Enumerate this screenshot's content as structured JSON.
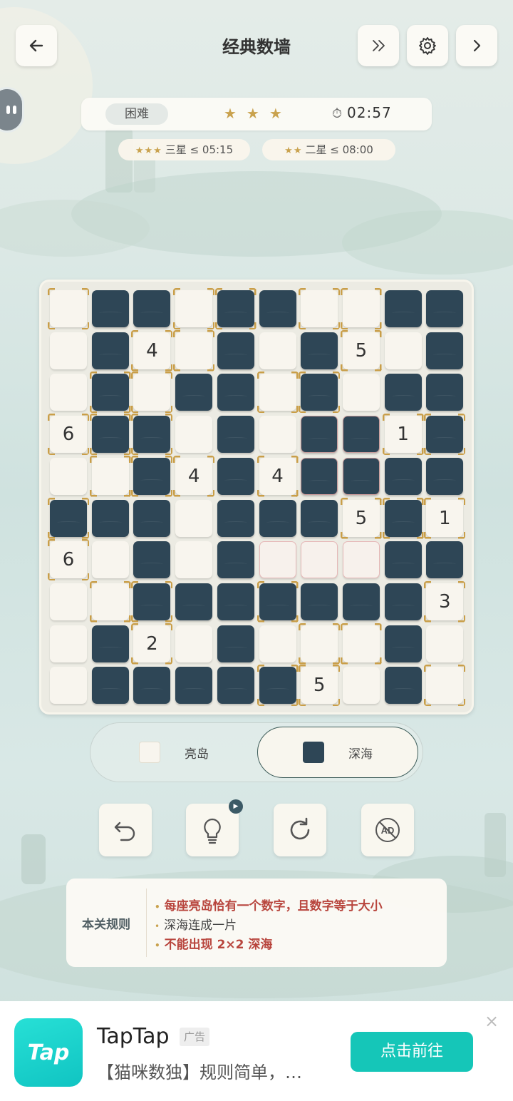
{
  "header": {
    "title": "经典数墙",
    "back_icon": "arrow-left-icon",
    "skip_icon": "double-chevron-right-icon",
    "settings_icon": "gear-icon",
    "next_icon": "chevron-right-icon"
  },
  "status": {
    "difficulty": "困难",
    "stars": "★★★",
    "timer": "02:57",
    "timer_icon": "⏱"
  },
  "goals": [
    {
      "stars": "★★★",
      "text": "三星 ≤ 05:15"
    },
    {
      "stars": "★★",
      "text": "二星 ≤ 08:00"
    }
  ],
  "board": {
    "size": 10,
    "legend": "L = light island, D = deep sea",
    "grid": [
      [
        "L",
        "D",
        "D",
        "L",
        "D",
        "D",
        "L",
        "L",
        "D",
        "D"
      ],
      [
        "L",
        "D",
        "L",
        "L",
        "D",
        "L",
        "D",
        "L",
        "L",
        "D"
      ],
      [
        "L",
        "D",
        "L",
        "D",
        "D",
        "L",
        "D",
        "L",
        "D",
        "D"
      ],
      [
        "L",
        "D",
        "D",
        "L",
        "D",
        "L",
        "D",
        "D",
        "L",
        "D"
      ],
      [
        "L",
        "L",
        "D",
        "L",
        "D",
        "L",
        "D",
        "D",
        "D",
        "D"
      ],
      [
        "D",
        "D",
        "D",
        "L",
        "D",
        "D",
        "D",
        "L",
        "D",
        "L"
      ],
      [
        "L",
        "L",
        "D",
        "L",
        "D",
        "L",
        "L",
        "L",
        "D",
        "D"
      ],
      [
        "L",
        "L",
        "D",
        "D",
        "D",
        "D",
        "D",
        "D",
        "D",
        "L"
      ],
      [
        "L",
        "D",
        "L",
        "L",
        "D",
        "L",
        "L",
        "L",
        "D",
        "L"
      ],
      [
        "L",
        "D",
        "D",
        "D",
        "D",
        "D",
        "L",
        "L",
        "D",
        "L"
      ]
    ],
    "numbers": [
      {
        "r": 1,
        "c": 2,
        "v": "4"
      },
      {
        "r": 1,
        "c": 7,
        "v": "5"
      },
      {
        "r": 3,
        "c": 0,
        "v": "6"
      },
      {
        "r": 3,
        "c": 8,
        "v": "1"
      },
      {
        "r": 4,
        "c": 3,
        "v": "4"
      },
      {
        "r": 4,
        "c": 5,
        "v": "4"
      },
      {
        "r": 5,
        "c": 7,
        "v": "5"
      },
      {
        "r": 5,
        "c": 9,
        "v": "1"
      },
      {
        "r": 6,
        "c": 0,
        "v": "6"
      },
      {
        "r": 7,
        "c": 9,
        "v": "3"
      },
      {
        "r": 8,
        "c": 2,
        "v": "2"
      },
      {
        "r": 9,
        "c": 6,
        "v": "5"
      }
    ],
    "gold_cells": [
      [
        0,
        0
      ],
      [
        0,
        3
      ],
      [
        0,
        4
      ],
      [
        0,
        6
      ],
      [
        0,
        7
      ],
      [
        1,
        2
      ],
      [
        1,
        3
      ],
      [
        1,
        7
      ],
      [
        2,
        1
      ],
      [
        2,
        2
      ],
      [
        2,
        5
      ],
      [
        2,
        6
      ],
      [
        3,
        0
      ],
      [
        3,
        1
      ],
      [
        3,
        2
      ],
      [
        3,
        8
      ],
      [
        3,
        9
      ],
      [
        4,
        1
      ],
      [
        4,
        2
      ],
      [
        4,
        3
      ],
      [
        4,
        5
      ],
      [
        5,
        0
      ],
      [
        5,
        7
      ],
      [
        5,
        8
      ],
      [
        5,
        9
      ],
      [
        6,
        0
      ],
      [
        7,
        1
      ],
      [
        7,
        2
      ],
      [
        7,
        5
      ],
      [
        7,
        9
      ],
      [
        8,
        2
      ],
      [
        8,
        6
      ],
      [
        8,
        7
      ],
      [
        9,
        5
      ],
      [
        9,
        6
      ],
      [
        9,
        9
      ]
    ],
    "error_cells": [
      [
        3,
        6
      ],
      [
        3,
        7
      ],
      [
        4,
        6
      ],
      [
        4,
        7
      ],
      [
        6,
        5
      ],
      [
        6,
        6
      ],
      [
        6,
        7
      ]
    ]
  },
  "modes": [
    {
      "label": "亮岛",
      "color": "#f8f5ee",
      "active": false
    },
    {
      "label": "深海",
      "color": "#2e4656",
      "active": true
    }
  ],
  "tools": [
    {
      "name": "undo-icon"
    },
    {
      "name": "lightbulb-icon",
      "badge": "▶"
    },
    {
      "name": "restart-icon"
    },
    {
      "name": "no-ads-icon",
      "label": "AD"
    }
  ],
  "rules": {
    "title": "本关规则",
    "items": [
      {
        "text": "每座亮岛恰有一个数字，且数字等于大小",
        "style": "red"
      },
      {
        "text": "深海连成一片",
        "style": "plain"
      },
      {
        "text": "不能出现 2×2 深海",
        "style": "red"
      }
    ]
  },
  "ad": {
    "logo_text": "Tap",
    "name": "TapTap",
    "tag": "广告",
    "description": "【猫咪数独】规则简单，…",
    "button": "点击前往",
    "close": "×"
  },
  "colors": {
    "deep_sea": "#2e4656",
    "island": "#f8f5ee",
    "gold": "#c99e48",
    "rule_red": "#b8453d",
    "ad_button": "#15c6b8"
  }
}
